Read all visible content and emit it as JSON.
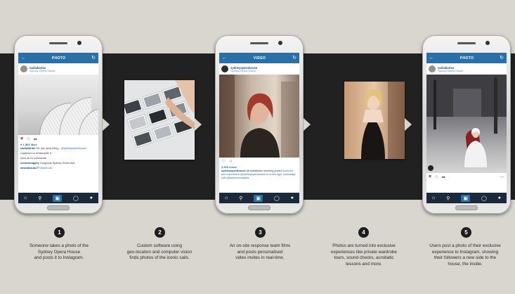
{
  "phones": [
    {
      "title": "PHOTO",
      "username": "nadialiartax",
      "location": "Sydney Opera House",
      "likes": "♥ 1,583 likes",
      "caption_user": "nadialiartax",
      "caption": "Oh, you sexy thing...",
      "caption_tag": "@sydneyoperahouse",
      "caption_extra": "Captured on #GalaxyS6 X",
      "view_all": "View all 24 comments",
      "comment1_user": "melanierappity",
      "comment1": "Gorgeous Sydney Great shot",
      "comment2_user": "amandasuaz77",
      "comment2": "@arthoria"
    },
    {
      "title": "VIDEO",
      "username": "sydneyoperahouse",
      "location": "Sydney Opera House",
      "likes": "2,906 views",
      "caption_user": "sydneyoperahouse",
      "caption": "@nadialiartax stunning photo!",
      "caption_tag": "#connect and experience @sydneyoperahouse in a new light, backstage with @karenconsidadia"
    },
    {
      "title": "PHOTO",
      "username": "nadialiartax",
      "location": "Sydney Opera House"
    }
  ],
  "icons": {
    "back": "back-arrow-icon",
    "refresh": "refresh-icon",
    "heart": "heart-icon",
    "comment": "comment-icon",
    "share": "share-icon",
    "more": "more-icon",
    "home": "home-icon",
    "search": "search-icon",
    "camera": "camera-icon",
    "activity": "activity-icon",
    "profile": "profile-icon"
  },
  "steps": [
    {
      "number": "1",
      "text": "Someone takes a photo of the\nSydney Opera House\nand posts it to Instagram."
    },
    {
      "number": "2",
      "text": "Custom software using\ngeo-location and computer vision\nfinds photos of the iconic sails."
    },
    {
      "number": "3",
      "text": "An on-site response team films\nand posts personalised\nvideo invites in real-time."
    },
    {
      "number": "4",
      "text": "Photos are turned into exclusive\nexperiences like private wardrobe\ntours, sound checks, acrobatic\nlessons and more."
    },
    {
      "number": "5",
      "text": "Users post a photo of their exclusive\nexperience to Instagram, showing\ntheir followers a new side to the\nhouse, the inside."
    }
  ],
  "colors": {
    "background": "#d9d5cf",
    "band": "#212121",
    "instagram_blue": "#2a6fa8",
    "nav_dark": "#1b2a3a",
    "like_red": "#d0312d"
  }
}
